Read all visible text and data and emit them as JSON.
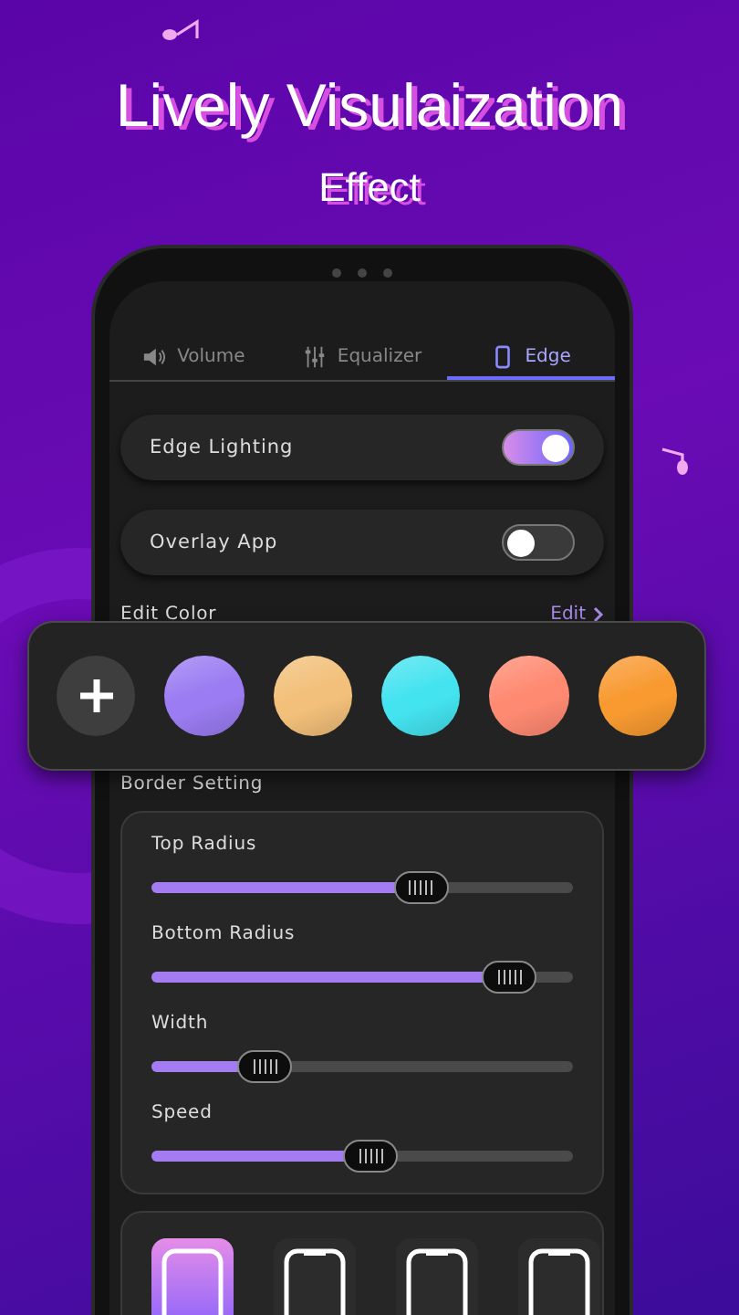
{
  "headline": {
    "title": "Lively Visulaization",
    "subtitle": "Effect"
  },
  "tabs": [
    {
      "label": "Volume",
      "selected": false
    },
    {
      "label": "Equalizer",
      "selected": false
    },
    {
      "label": "Edge",
      "selected": true
    }
  ],
  "toggles": [
    {
      "label": "Edge Lighting",
      "on": true
    },
    {
      "label": "Overlay App",
      "on": false
    }
  ],
  "edit_color": {
    "title": "Edit Color",
    "action": "Edit"
  },
  "colors": [
    {
      "color": "#9b7cf2"
    },
    {
      "color": "#f2c07a"
    },
    {
      "color": "#44e3f0"
    },
    {
      "color": "#ff8a72"
    },
    {
      "color": "#f89a30"
    }
  ],
  "border_setting": {
    "title": "Border Setting",
    "sliders": [
      {
        "label": "Top Radius",
        "level": 0.64
      },
      {
        "label": "Bottom Radius",
        "level": 0.85
      },
      {
        "label": "Width",
        "level": 0.27
      },
      {
        "label": "Speed",
        "level": 0.52
      }
    ]
  },
  "styles": [
    {
      "kind": "plain",
      "selected": true
    },
    {
      "kind": "notch",
      "selected": false
    },
    {
      "kind": "notch",
      "selected": false
    },
    {
      "kind": "notch",
      "selected": false
    }
  ]
}
